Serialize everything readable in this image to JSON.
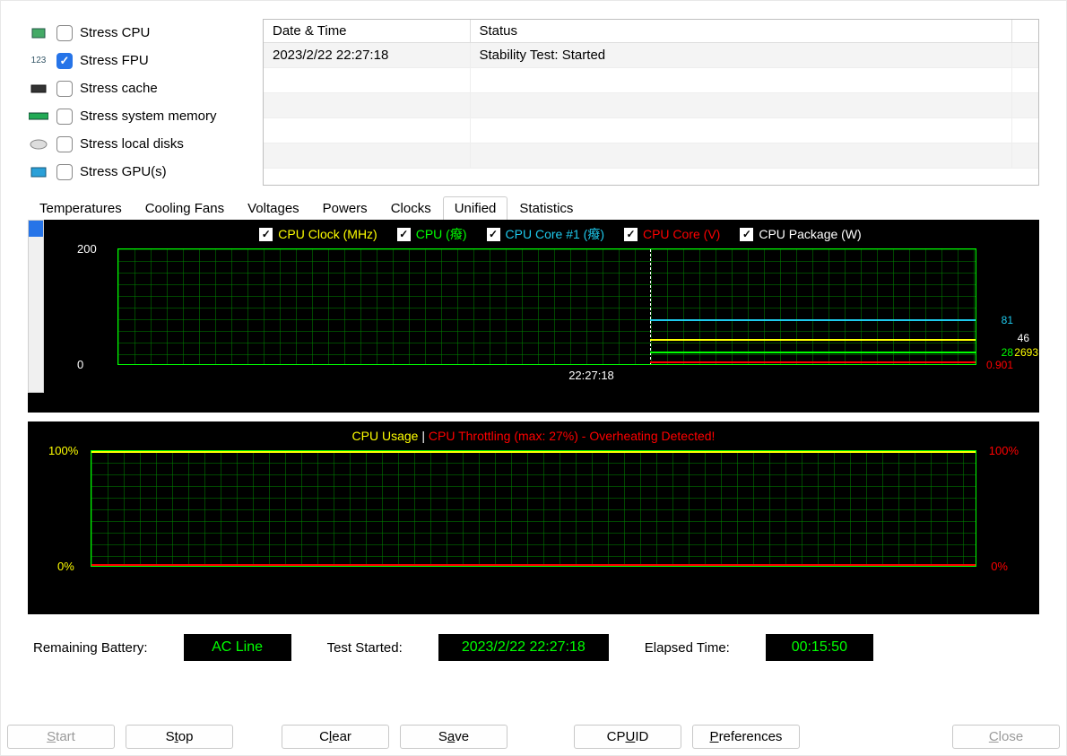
{
  "stress_options": [
    {
      "label": "Stress CPU",
      "checked": false,
      "icon": "cpu-icon"
    },
    {
      "label": "Stress FPU",
      "checked": true,
      "icon": "fpu-icon"
    },
    {
      "label": "Stress cache",
      "checked": false,
      "icon": "cache-icon"
    },
    {
      "label": "Stress system memory",
      "checked": false,
      "icon": "ram-icon"
    },
    {
      "label": "Stress local disks",
      "checked": false,
      "icon": "disk-icon"
    },
    {
      "label": "Stress GPU(s)",
      "checked": false,
      "icon": "gpu-icon"
    }
  ],
  "log": {
    "headers": [
      "Date & Time",
      "Status"
    ],
    "rows": [
      {
        "datetime": "2023/2/22 22:27:18",
        "status": "Stability Test: Started"
      }
    ]
  },
  "tabs": [
    "Temperatures",
    "Cooling Fans",
    "Voltages",
    "Powers",
    "Clocks",
    "Unified",
    "Statistics"
  ],
  "active_tab": "Unified",
  "chart_data": {
    "type": "line",
    "title": "",
    "y_ticks": [
      "200",
      "0"
    ],
    "x_marker": "22:27:18",
    "x_range_percent_marker": 62,
    "series": [
      {
        "name": "CPU Clock (MHz)",
        "color": "#ffff00",
        "current": 2693,
        "approx_level": 26
      },
      {
        "name": "CPU (癈)",
        "color": "#00ff00",
        "current": 28,
        "approx_level": 12
      },
      {
        "name": "CPU Core #1 (癈)",
        "color": "#1ec9ec",
        "current": 81,
        "approx_level": 48
      },
      {
        "name": "CPU Core (V)",
        "color": "#ff0000",
        "current": 0.901,
        "approx_level": 1
      },
      {
        "name": "CPU Package (W)",
        "color": "#ffffff",
        "current": 46.0,
        "approx_level": 30
      }
    ],
    "legend_labels": {
      "cpuclock": "CPU Clock (MHz)",
      "cpu": "CPU (癈)",
      "core1": "CPU Core #1 (癈)",
      "coreV": "CPU Core (V)",
      "pkgW": "CPU Package (W)"
    }
  },
  "chart2": {
    "titleL": "CPU Usage",
    "sep": "  |  ",
    "titleR": "CPU Throttling (max: 27%) - Overheating Detected!",
    "y_top_left": "100%",
    "y_bot_left": "0%",
    "y_top_right": "100%",
    "y_bot_right": "0%",
    "usage_value": 100,
    "throttle_value": 0
  },
  "status": {
    "battery_label": "Remaining Battery:",
    "battery_value": "AC Line",
    "started_label": "Test Started:",
    "started_value": "2023/2/22 22:27:18",
    "elapsed_label": "Elapsed Time:",
    "elapsed_value": "00:15:50"
  },
  "buttons": {
    "start": "Start",
    "stop": "Stop",
    "clear": "Clear",
    "save": "Save",
    "cpuid": "CPUID",
    "prefs": "Preferences",
    "close": "Close"
  }
}
